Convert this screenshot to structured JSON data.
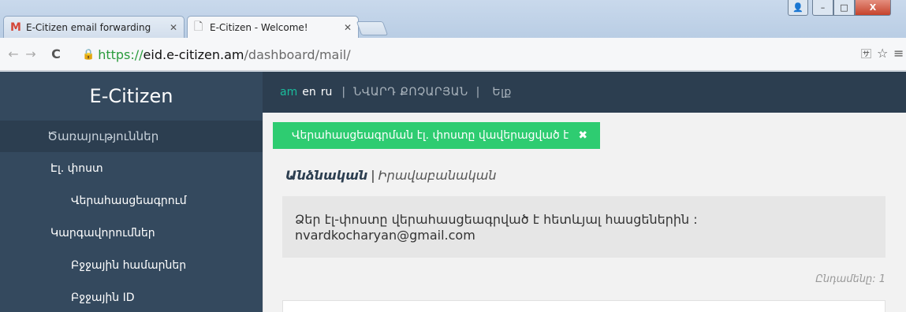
{
  "browser": {
    "tabs": [
      {
        "title": "E-Citizen email forwarding",
        "favicon": "gmail-icon",
        "active": false
      },
      {
        "title": "E-Citizen - Welcome!",
        "favicon": "page-icon",
        "active": true
      }
    ],
    "url": {
      "scheme": "https://",
      "host": "eid.e-citizen.am",
      "path": "/dashboard/mail/"
    },
    "window_controls": {
      "minimize": "–",
      "maximize": "□",
      "close": "X"
    }
  },
  "sidebar": {
    "brand": "E-Citizen",
    "section_title": "Ծառայություններ",
    "items": [
      {
        "label": "Էլ. փոստ",
        "level": 1
      },
      {
        "label": "Վերահասցեագրում",
        "level": 2
      },
      {
        "label": "Կարգավորումներ",
        "level": 1
      },
      {
        "label": "Բջջային համարներ",
        "level": 2
      },
      {
        "label": "Բջջային ID",
        "level": 2
      }
    ]
  },
  "topnav": {
    "languages": [
      "am",
      "en",
      "ru"
    ],
    "current_language": "am",
    "user_name": "ՆՎԱՐԴ ՔՈՉԱՐՅԱՆ",
    "logout": "Ելք"
  },
  "alert": {
    "text": "Վերահասցեագրման էլ. փոստը վավերացված է",
    "close": "✖"
  },
  "subtabs": {
    "active": "Անձնական",
    "separator": "|",
    "other": "Իրավաբանական"
  },
  "notice": {
    "text": "Ձեր էլ-փոստը վերահասցեագրված է հետևյալ հասցեներին :",
    "email": "nvardkocharyan@gmail.com"
  },
  "count_label": "Ընդամենը: 1"
}
